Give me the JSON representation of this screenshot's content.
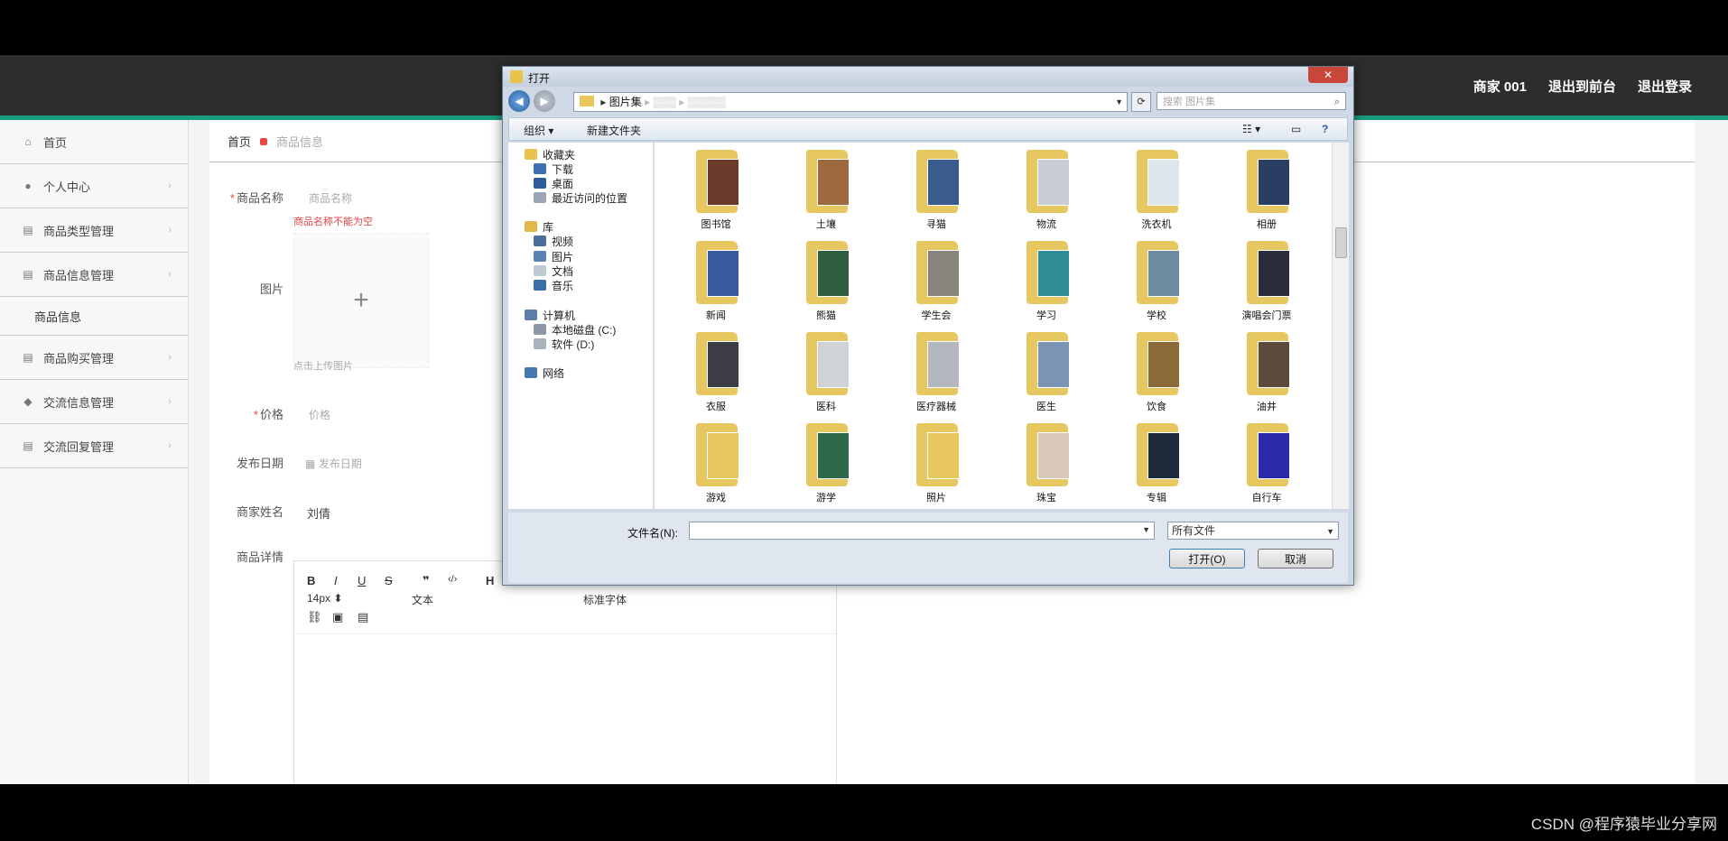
{
  "topbar": {
    "merchant": "商家 001",
    "exit_front": "退出到前台",
    "logout": "退出登录"
  },
  "sidebar": {
    "items": [
      {
        "label": "首页",
        "icon": "home-icon"
      },
      {
        "label": "个人中心",
        "icon": "user-icon"
      },
      {
        "label": "商品类型管理",
        "icon": "list-icon"
      },
      {
        "label": "商品信息管理",
        "icon": "list-icon"
      },
      {
        "label": "商品购买管理",
        "icon": "list-icon"
      },
      {
        "label": "交流信息管理",
        "icon": "location-icon"
      },
      {
        "label": "交流回复管理",
        "icon": "list-icon"
      }
    ],
    "sub_item": "商品信息"
  },
  "breadcrumb": {
    "home": "首页",
    "current": "商品信息"
  },
  "form": {
    "name_label": "商品名称",
    "name_placeholder": "商品名称",
    "name_error": "商品名称不能为空",
    "image_label": "图片",
    "upload_hint": "点击上传图片",
    "price_label": "价格",
    "price_placeholder": "价格",
    "date_label": "发布日期",
    "date_placeholder": "发布日期",
    "merchant_label": "商家姓名",
    "merchant_value": "刘倩",
    "detail_label": "商品详情"
  },
  "editor_toolbar": {
    "font_size": "14px",
    "paragraph": "文本",
    "font_family": "标准字体",
    "heading": "H"
  },
  "dialog": {
    "title": "打开",
    "address_folder": "图片集",
    "search_placeholder": "搜索 图片集",
    "organize": "组织 ▾",
    "new_folder": "新建文件夹",
    "nav": [
      {
        "label": "收藏夹",
        "color": "#e8c44a"
      },
      {
        "label": "下载",
        "color": "#3d6fb4"
      },
      {
        "label": "桌面",
        "color": "#2e5c9a"
      },
      {
        "label": "最近访问的位置",
        "color": "#9aa6b4"
      },
      {
        "label": "库",
        "color": "#e2b84a"
      },
      {
        "label": "视频",
        "color": "#4a6e9c"
      },
      {
        "label": "图片",
        "color": "#5a82b2"
      },
      {
        "label": "文档",
        "color": "#c0c8d2"
      },
      {
        "label": "音乐",
        "color": "#3a6ea8"
      },
      {
        "label": "计算机",
        "color": "#5b7fa8"
      },
      {
        "label": "本地磁盘 (C:)",
        "color": "#8c98a8"
      },
      {
        "label": "软件 (D:)",
        "color": "#aab2bc"
      },
      {
        "label": "网络",
        "color": "#4678b0"
      }
    ],
    "files": [
      {
        "label": "图书馆",
        "pic": "#6b3a2a"
      },
      {
        "label": "土壤",
        "pic": "#9c6a3e"
      },
      {
        "label": "寻猫",
        "pic": "#3a5c8c"
      },
      {
        "label": "物流",
        "pic": "#c8ccd4"
      },
      {
        "label": "洗衣机",
        "pic": "#dde6ea"
      },
      {
        "label": "相册",
        "pic": "#2a3e64"
      },
      {
        "label": "新闻",
        "pic": "#3a5aa0"
      },
      {
        "label": "熊猫",
        "pic": "#2e5c3e"
      },
      {
        "label": "学生会",
        "pic": "#88837c"
      },
      {
        "label": "学习",
        "pic": "#2e8c94"
      },
      {
        "label": "学校",
        "pic": "#6c8aa0"
      },
      {
        "label": "演唱会门票",
        "pic": "#2a2e3a"
      },
      {
        "label": "衣服",
        "pic": "#3c3c44"
      },
      {
        "label": "医科",
        "pic": "#cfd2d6"
      },
      {
        "label": "医疗器械",
        "pic": "#b4b8be"
      },
      {
        "label": "医生",
        "pic": "#7c94b4"
      },
      {
        "label": "饮食",
        "pic": "#8c6a3a"
      },
      {
        "label": "油井",
        "pic": "#5c4a3a"
      },
      {
        "label": "游戏",
        "pic": "#e7c860"
      },
      {
        "label": "游学",
        "pic": "#2e6a4a"
      },
      {
        "label": "照片",
        "pic": "#e7c860"
      },
      {
        "label": "珠宝",
        "pic": "#d8c8b8"
      },
      {
        "label": "专辑",
        "pic": "#1e2a3a"
      },
      {
        "label": "自行车",
        "pic": "#2a2aa8"
      }
    ],
    "filename_label": "文件名(N):",
    "filename_value": "",
    "filter": "所有文件",
    "open_button": "打开(O)",
    "cancel_button": "取消"
  },
  "watermark": "CSDN @程序猿毕业分享网"
}
